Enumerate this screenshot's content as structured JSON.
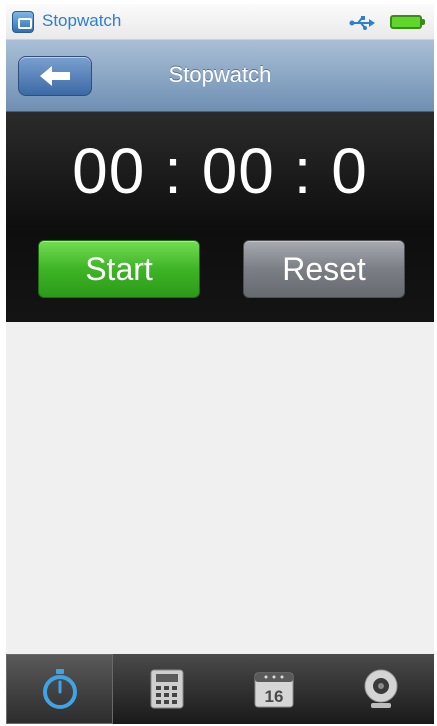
{
  "status_bar": {
    "app_icon": "stopwatch-app-icon",
    "title": "Stopwatch",
    "usb_icon": "usb-icon",
    "battery_icon": "battery-icon"
  },
  "title_bar": {
    "back_icon": "back-arrow-icon",
    "title": "Stopwatch"
  },
  "timer": {
    "display": "00 : 00 : 0"
  },
  "controls": {
    "start_label": "Start",
    "reset_label": "Reset"
  },
  "tabs": [
    {
      "icon": "stopwatch-icon",
      "active": true
    },
    {
      "icon": "calculator-icon",
      "active": false
    },
    {
      "icon": "calendar-icon",
      "label": "16",
      "active": false
    },
    {
      "icon": "webcam-icon",
      "active": false
    }
  ],
  "colors": {
    "status_title": "#2d7fd0",
    "title_bar": "#8aa6c4",
    "start_button": "#3eb426",
    "reset_button": "#7c7e86",
    "active_tab_icon": "#3fa3e6"
  }
}
